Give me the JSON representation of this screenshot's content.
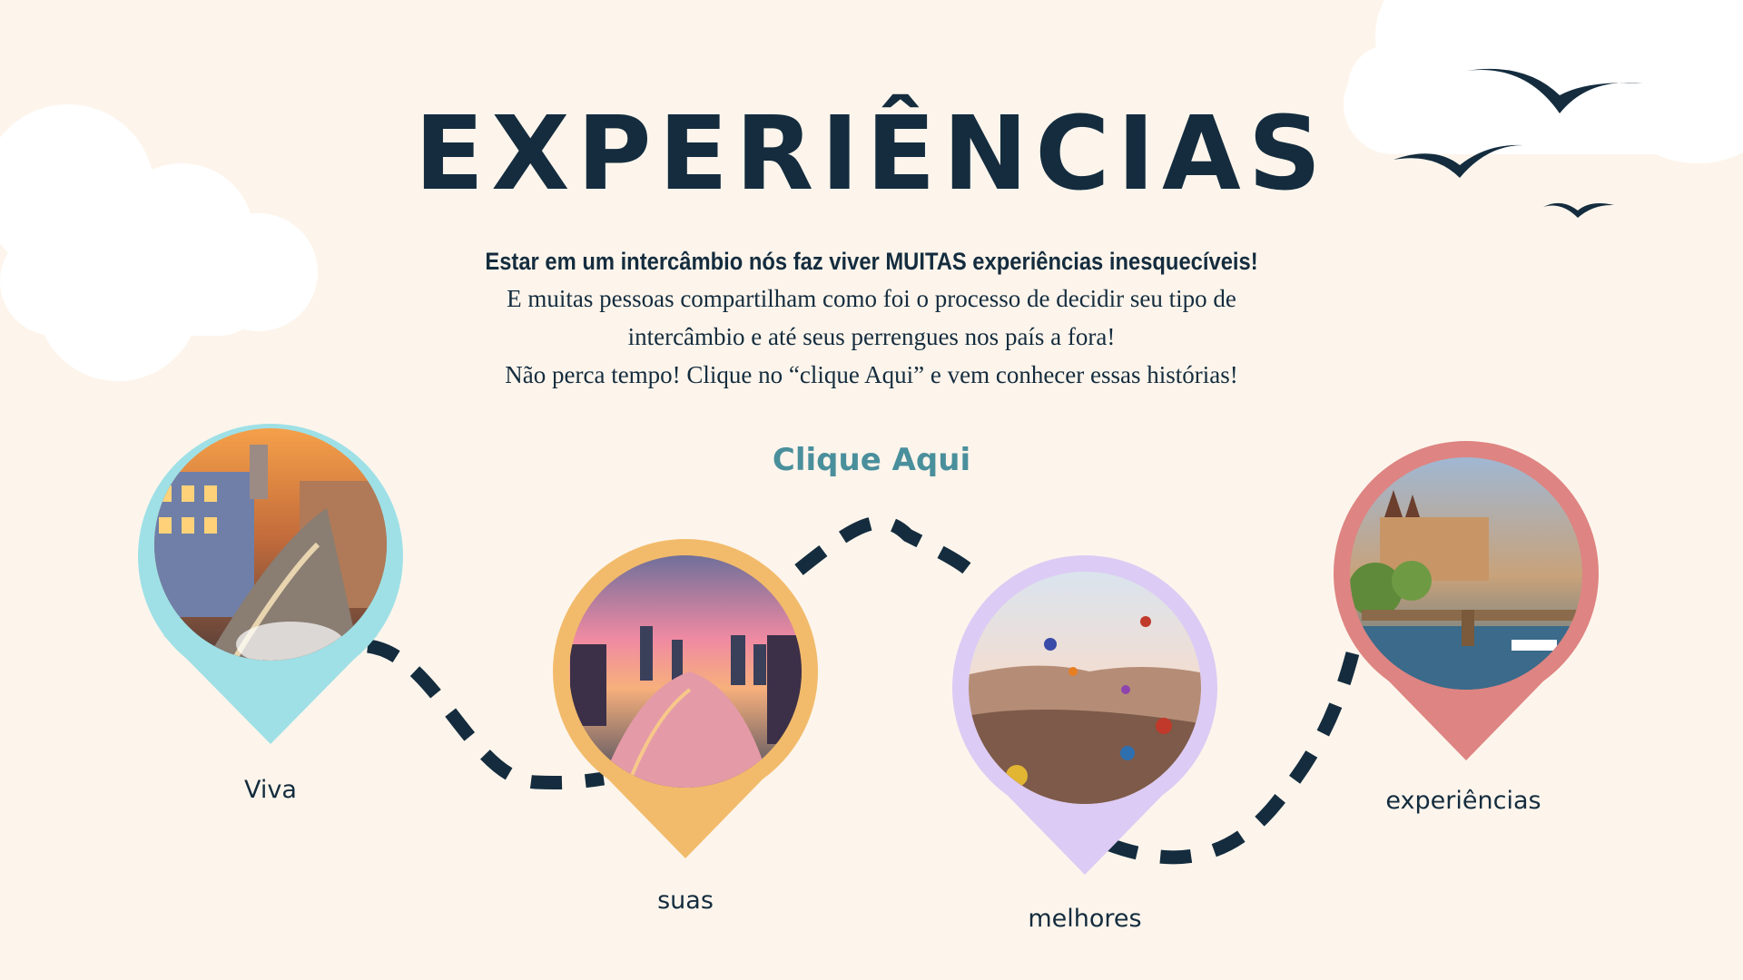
{
  "slide": {
    "title": "EXPERIÊNCIAS",
    "intro": {
      "lead": "Estar em um intercâmbio nós faz viver MUITAS experiências inesquecíveis!",
      "line1": "E muitas pessoas compartilham como foi o processo de decidir seu tipo de",
      "line2": "intercâmbio e até seus perrengues nos país a fora!",
      "line3": "Não perca tempo! Clique no “clique Aqui” e vem conhecer essas histórias!"
    },
    "cta_label": "Clique Aqui",
    "pins": [
      {
        "label": "Viva",
        "color": "#9fe0e6",
        "scene": "old-town-street-at-dusk"
      },
      {
        "label": "suas",
        "color": "#f2bb6b",
        "scene": "city-skyline-over-river"
      },
      {
        "label": "melhores",
        "color": "#dccbf4",
        "scene": "hot-air-balloons-over-valley"
      },
      {
        "label": "experiências",
        "color": "#de8482",
        "scene": "bridge-and-castle-over-river"
      }
    ],
    "colors": {
      "background": "#fdf5ec",
      "ink": "#142c3e",
      "cta": "#4a8f9c"
    }
  }
}
